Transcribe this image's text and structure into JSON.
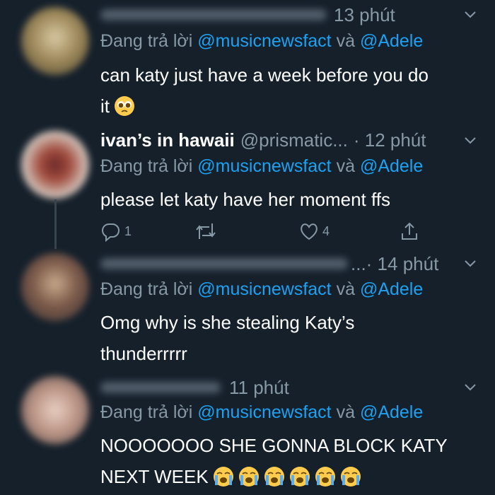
{
  "tweets": [
    {
      "time": "13 phút",
      "reply_prefix": "Đang trả lời",
      "reply_mention1": "@musicnewsfact",
      "reply_joiner": "và",
      "reply_mention2": "@Adele",
      "body_line1": "can katy just have a week before you do",
      "body_line2": "it"
    },
    {
      "name": "ivan’s in hawaii",
      "handle": "@prismatic...",
      "time": "· 12 phút",
      "reply_prefix": "Đang trả lời",
      "reply_mention1": "@musicnewsfact",
      "reply_joiner": "và",
      "reply_mention2": "@Adele",
      "body_line1": "please let katy have her moment ffs",
      "reply_count": "1",
      "like_count": "4"
    },
    {
      "handle_tail": "...",
      "time": "· 14 phút",
      "reply_prefix": "Đang trả lời",
      "reply_mention1": "@musicnewsfact",
      "reply_joiner": "và",
      "reply_mention2": "@Adele",
      "body_line1": "Omg why is she stealing Katy’s",
      "body_line2": "thunderrrrr"
    },
    {
      "time": "11 phút",
      "reply_prefix": "Đang trả lời",
      "reply_mention1": "@musicnewsfact",
      "reply_joiner": "và",
      "reply_mention2": "@Adele",
      "body_line1": "NOOOOOOO SHE GONNA BLOCK KATY",
      "body_line2": "NEXT WEEK"
    }
  ],
  "icons": {
    "caret": "chevron-down-icon",
    "reply": "reply-icon",
    "retweet": "retweet-icon",
    "like": "heart-icon",
    "share": "share-icon",
    "pleading": "pleading-face-emoji",
    "crying": "loudly-crying-face-emoji"
  },
  "colors": {
    "background": "#15202b",
    "text": "#ffffff",
    "secondary": "#8899a6",
    "mention": "#1da1f2"
  }
}
